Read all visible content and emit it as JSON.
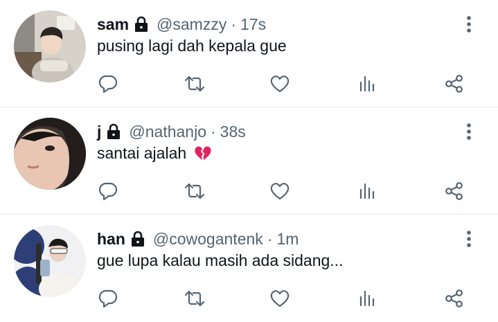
{
  "tweets": [
    {
      "name": "sam",
      "handle": "@samzzy",
      "separator": "·",
      "time": "17s",
      "text": "pusing lagi dah kepala gue",
      "emoji": ""
    },
    {
      "name": "j",
      "handle": "@nathanjo",
      "separator": "·",
      "time": "38s",
      "text": "santai ajalah",
      "emoji": "broken-heart-emoji"
    },
    {
      "name": "han",
      "handle": "@cowogantenk",
      "separator": "·",
      "time": "1m",
      "text": "gue lupa kalau masih ada sidang...",
      "emoji": ""
    }
  ],
  "icons": {
    "lock": "lock-icon",
    "more": "more-vertical-icon",
    "reply": "reply-icon",
    "retweet": "retweet-icon",
    "like": "heart-icon",
    "views": "views-chart-icon",
    "share": "share-icon"
  },
  "colors": {
    "text_primary": "#0f1419",
    "text_secondary": "#536471",
    "divider": "#e4e8ec",
    "broken_heart": "#e0245e"
  }
}
